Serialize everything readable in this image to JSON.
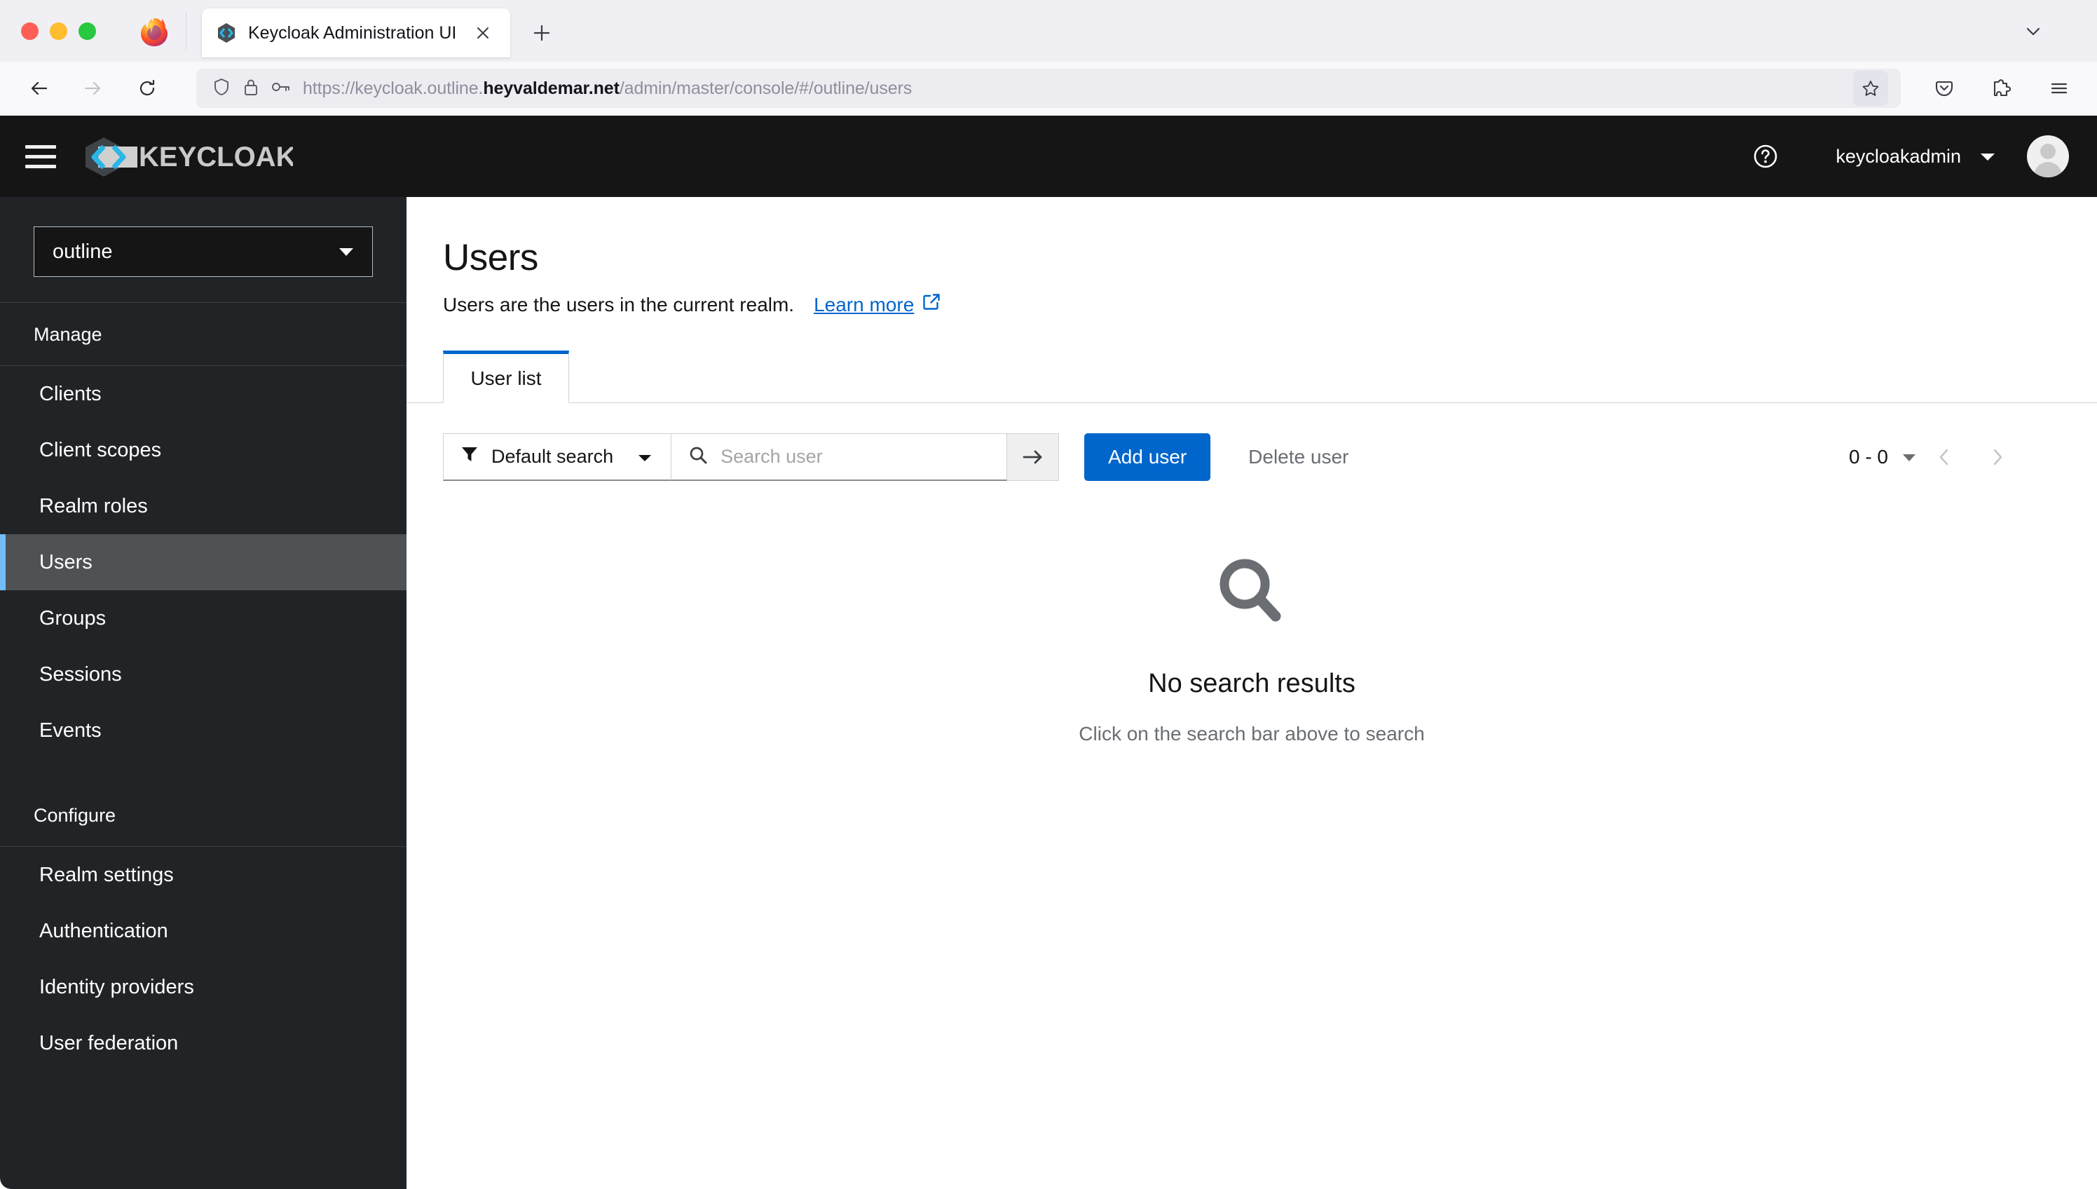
{
  "browser": {
    "tab": {
      "title": "Keycloak Administration UI",
      "favicon": "keycloak-favicon",
      "close_label": "×"
    },
    "newtab_label": "+",
    "url": {
      "prefix": "https://keycloak.outline.",
      "domain": "heyvaldemar.net",
      "path": "/admin/master/console/#/outline/users",
      "full": "https://keycloak.outline.heyvaldemar.net/admin/master/console/#/outline/users"
    },
    "icons": {
      "back": "back-arrow-icon",
      "forward": "forward-arrow-icon",
      "reload": "reload-icon",
      "shield": "tracking-protection-shield-icon",
      "lock": "padlock-icon",
      "permissions": "key-icon",
      "bookmark": "star-icon",
      "pocket": "pocket-icon",
      "extensions": "puzzle-piece-icon",
      "menu": "hamburger-menu-icon",
      "tab_list": "chevron-down-icon"
    }
  },
  "masthead": {
    "brand": "KEYCLOAK",
    "help_icon": "question-circle-icon",
    "username": "keycloakadmin",
    "user_caret": "caret-down-icon",
    "avatar": "user-avatar-icon",
    "toggle_icon": "hamburger-menu-icon"
  },
  "sidebar": {
    "realm_selected": "outline",
    "realm_caret": "caret-down-icon",
    "sections": [
      {
        "heading": "Manage",
        "items": [
          {
            "label": "Clients",
            "active": false
          },
          {
            "label": "Client scopes",
            "active": false
          },
          {
            "label": "Realm roles",
            "active": false
          },
          {
            "label": "Users",
            "active": true
          },
          {
            "label": "Groups",
            "active": false
          },
          {
            "label": "Sessions",
            "active": false
          },
          {
            "label": "Events",
            "active": false
          }
        ]
      },
      {
        "heading": "Configure",
        "items": [
          {
            "label": "Realm settings",
            "active": false
          },
          {
            "label": "Authentication",
            "active": false
          },
          {
            "label": "Identity providers",
            "active": false
          },
          {
            "label": "User federation",
            "active": false
          }
        ]
      }
    ]
  },
  "page": {
    "title": "Users",
    "description": "Users are the users in the current realm.",
    "learn_more": "Learn more",
    "learn_more_icon": "external-link-icon",
    "tabs": [
      {
        "label": "User list",
        "active": true
      }
    ]
  },
  "toolbar": {
    "filter_label": "Default search",
    "filter_icon": "funnel-filter-icon",
    "filter_caret": "caret-down-icon",
    "search_placeholder": "Search user",
    "search_value": "",
    "search_icon": "magnifier-icon",
    "search_go_icon": "arrow-right-icon",
    "add_user_label": "Add user",
    "delete_user_label": "Delete user",
    "delete_user_disabled": true,
    "pagination": {
      "range": "0 - 0",
      "caret": "caret-down-icon",
      "prev_icon": "chevron-left-icon",
      "next_icon": "chevron-right-icon",
      "prev_disabled": true,
      "next_disabled": true
    }
  },
  "empty_state": {
    "icon": "magnifier-icon",
    "title": "No search results",
    "body": "Click on the search bar above to search"
  },
  "colors": {
    "accent_blue": "#06c",
    "masthead_bg": "#151515",
    "sidebar_bg": "#212427",
    "sidebar_active_bg": "#4f5255",
    "sidebar_active_border": "#73bcf7",
    "muted_text": "#6a6e73"
  }
}
